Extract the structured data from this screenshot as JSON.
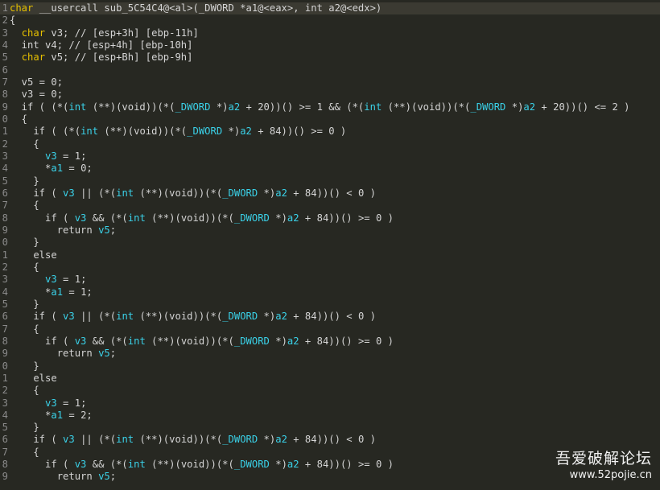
{
  "function_signature": "char __usercall sub_5C54C4@<al>(_DWORD *a1@<eax>, int a2@<edx>)",
  "lines": [
    {
      "num": "1",
      "highlight": true,
      "tokens": [
        [
          "type",
          "char"
        ],
        [
          "plain",
          " __usercall sub_5C54C4@<al>(_DWORD *a1@<eax>, int a2@<edx>)"
        ]
      ]
    },
    {
      "num": "2",
      "tokens": [
        [
          "plain",
          "{"
        ]
      ]
    },
    {
      "num": "3",
      "tokens": [
        [
          "plain",
          "  "
        ],
        [
          "type",
          "char"
        ],
        [
          "plain",
          " v3; // [esp+3h] [ebp-11h]"
        ]
      ]
    },
    {
      "num": "4",
      "tokens": [
        [
          "plain",
          "  int v4; // [esp+4h] [ebp-10h]"
        ]
      ]
    },
    {
      "num": "5",
      "tokens": [
        [
          "plain",
          "  "
        ],
        [
          "type",
          "char"
        ],
        [
          "plain",
          " v5; // [esp+Bh] [ebp-9h]"
        ]
      ]
    },
    {
      "num": "6",
      "tokens": [
        [
          "plain",
          ""
        ]
      ]
    },
    {
      "num": "7",
      "tokens": [
        [
          "plain",
          "  v5 = 0;"
        ]
      ]
    },
    {
      "num": "8",
      "tokens": [
        [
          "plain",
          "  v3 = 0;"
        ]
      ]
    },
    {
      "num": "9",
      "tokens": [
        [
          "plain",
          "  if ( (*("
        ],
        [
          "var",
          "int"
        ],
        [
          "plain",
          " (**)(void))(*("
        ],
        [
          "ptr",
          "_DWORD"
        ],
        [
          "plain",
          " *)"
        ],
        [
          "var",
          "a2"
        ],
        [
          "plain",
          " + 20))() >= 1 && (*("
        ],
        [
          "var",
          "int"
        ],
        [
          "plain",
          " (**)(void))(*("
        ],
        [
          "ptr",
          "_DWORD"
        ],
        [
          "plain",
          " *)"
        ],
        [
          "var",
          "a2"
        ],
        [
          "plain",
          " + 20))() <= 2 )"
        ]
      ]
    },
    {
      "num": "0",
      "tokens": [
        [
          "plain",
          "  {"
        ]
      ]
    },
    {
      "num": "1",
      "tokens": [
        [
          "plain",
          "    if ( (*("
        ],
        [
          "var",
          "int"
        ],
        [
          "plain",
          " (**)(void))(*("
        ],
        [
          "ptr",
          "_DWORD"
        ],
        [
          "plain",
          " *)"
        ],
        [
          "var",
          "a2"
        ],
        [
          "plain",
          " + 84))() >= 0 )"
        ]
      ]
    },
    {
      "num": "2",
      "tokens": [
        [
          "plain",
          "    {"
        ]
      ]
    },
    {
      "num": "3",
      "tokens": [
        [
          "plain",
          "      "
        ],
        [
          "var",
          "v3"
        ],
        [
          "plain",
          " = 1;"
        ]
      ]
    },
    {
      "num": "4",
      "tokens": [
        [
          "plain",
          "      *"
        ],
        [
          "var",
          "a1"
        ],
        [
          "plain",
          " = 0;"
        ]
      ]
    },
    {
      "num": "5",
      "tokens": [
        [
          "plain",
          "    }"
        ]
      ]
    },
    {
      "num": "6",
      "tokens": [
        [
          "plain",
          "    if ( "
        ],
        [
          "var",
          "v3"
        ],
        [
          "plain",
          " || (*("
        ],
        [
          "var",
          "int"
        ],
        [
          "plain",
          " (**)(void))(*("
        ],
        [
          "ptr",
          "_DWORD"
        ],
        [
          "plain",
          " *)"
        ],
        [
          "var",
          "a2"
        ],
        [
          "plain",
          " + 84))() < 0 )"
        ]
      ]
    },
    {
      "num": "7",
      "tokens": [
        [
          "plain",
          "    {"
        ]
      ]
    },
    {
      "num": "8",
      "tokens": [
        [
          "plain",
          "      if ( "
        ],
        [
          "var",
          "v3"
        ],
        [
          "plain",
          " && (*("
        ],
        [
          "var",
          "int"
        ],
        [
          "plain",
          " (**)(void))(*("
        ],
        [
          "ptr",
          "_DWORD"
        ],
        [
          "plain",
          " *)"
        ],
        [
          "var",
          "a2"
        ],
        [
          "plain",
          " + 84))() >= 0 )"
        ]
      ]
    },
    {
      "num": "9",
      "tokens": [
        [
          "plain",
          "        return "
        ],
        [
          "var",
          "v5"
        ],
        [
          "plain",
          ";"
        ]
      ]
    },
    {
      "num": "0",
      "tokens": [
        [
          "plain",
          "    }"
        ]
      ]
    },
    {
      "num": "1",
      "tokens": [
        [
          "plain",
          "    else"
        ]
      ]
    },
    {
      "num": "2",
      "tokens": [
        [
          "plain",
          "    {"
        ]
      ]
    },
    {
      "num": "3",
      "tokens": [
        [
          "plain",
          "      "
        ],
        [
          "var",
          "v3"
        ],
        [
          "plain",
          " = 1;"
        ]
      ]
    },
    {
      "num": "4",
      "tokens": [
        [
          "plain",
          "      *"
        ],
        [
          "var",
          "a1"
        ],
        [
          "plain",
          " = 1;"
        ]
      ]
    },
    {
      "num": "5",
      "tokens": [
        [
          "plain",
          "    }"
        ]
      ]
    },
    {
      "num": "6",
      "tokens": [
        [
          "plain",
          "    if ( "
        ],
        [
          "var",
          "v3"
        ],
        [
          "plain",
          " || (*("
        ],
        [
          "var",
          "int"
        ],
        [
          "plain",
          " (**)(void))(*("
        ],
        [
          "ptr",
          "_DWORD"
        ],
        [
          "plain",
          " *)"
        ],
        [
          "var",
          "a2"
        ],
        [
          "plain",
          " + 84))() < 0 )"
        ]
      ]
    },
    {
      "num": "7",
      "tokens": [
        [
          "plain",
          "    {"
        ]
      ]
    },
    {
      "num": "8",
      "tokens": [
        [
          "plain",
          "      if ( "
        ],
        [
          "var",
          "v3"
        ],
        [
          "plain",
          " && (*("
        ],
        [
          "var",
          "int"
        ],
        [
          "plain",
          " (**)(void))(*("
        ],
        [
          "ptr",
          "_DWORD"
        ],
        [
          "plain",
          " *)"
        ],
        [
          "var",
          "a2"
        ],
        [
          "plain",
          " + 84))() >= 0 )"
        ]
      ]
    },
    {
      "num": "9",
      "tokens": [
        [
          "plain",
          "        return "
        ],
        [
          "var",
          "v5"
        ],
        [
          "plain",
          ";"
        ]
      ]
    },
    {
      "num": "0",
      "tokens": [
        [
          "plain",
          "    }"
        ]
      ]
    },
    {
      "num": "1",
      "tokens": [
        [
          "plain",
          "    else"
        ]
      ]
    },
    {
      "num": "2",
      "tokens": [
        [
          "plain",
          "    {"
        ]
      ]
    },
    {
      "num": "3",
      "tokens": [
        [
          "plain",
          "      "
        ],
        [
          "var",
          "v3"
        ],
        [
          "plain",
          " = 1;"
        ]
      ]
    },
    {
      "num": "4",
      "tokens": [
        [
          "plain",
          "      *"
        ],
        [
          "var",
          "a1"
        ],
        [
          "plain",
          " = 2;"
        ]
      ]
    },
    {
      "num": "5",
      "tokens": [
        [
          "plain",
          "    }"
        ]
      ]
    },
    {
      "num": "6",
      "tokens": [
        [
          "plain",
          "    if ( "
        ],
        [
          "var",
          "v3"
        ],
        [
          "plain",
          " || (*("
        ],
        [
          "var",
          "int"
        ],
        [
          "plain",
          " (**)(void))(*("
        ],
        [
          "ptr",
          "_DWORD"
        ],
        [
          "plain",
          " *)"
        ],
        [
          "var",
          "a2"
        ],
        [
          "plain",
          " + 84))() < 0 )"
        ]
      ]
    },
    {
      "num": "7",
      "tokens": [
        [
          "plain",
          "    {"
        ]
      ]
    },
    {
      "num": "8",
      "tokens": [
        [
          "plain",
          "      if ( "
        ],
        [
          "var",
          "v3"
        ],
        [
          "plain",
          " && (*("
        ],
        [
          "var",
          "int"
        ],
        [
          "plain",
          " (**)(void))(*("
        ],
        [
          "ptr",
          "_DWORD"
        ],
        [
          "plain",
          " *)"
        ],
        [
          "var",
          "a2"
        ],
        [
          "plain",
          " + 84))() >= 0 )"
        ]
      ]
    },
    {
      "num": "9",
      "tokens": [
        [
          "plain",
          "        return "
        ],
        [
          "var",
          "v5"
        ],
        [
          "plain",
          ";"
        ]
      ]
    }
  ],
  "watermark": {
    "title": "吾爱破解论坛",
    "url": "www.52pojie.cn"
  },
  "colors": {
    "background": "#272822",
    "type_keyword": "#e6c000",
    "identifier": "#3ad1e8",
    "plain_text": "#d4d4d4",
    "line_number": "#8a8a8a"
  }
}
